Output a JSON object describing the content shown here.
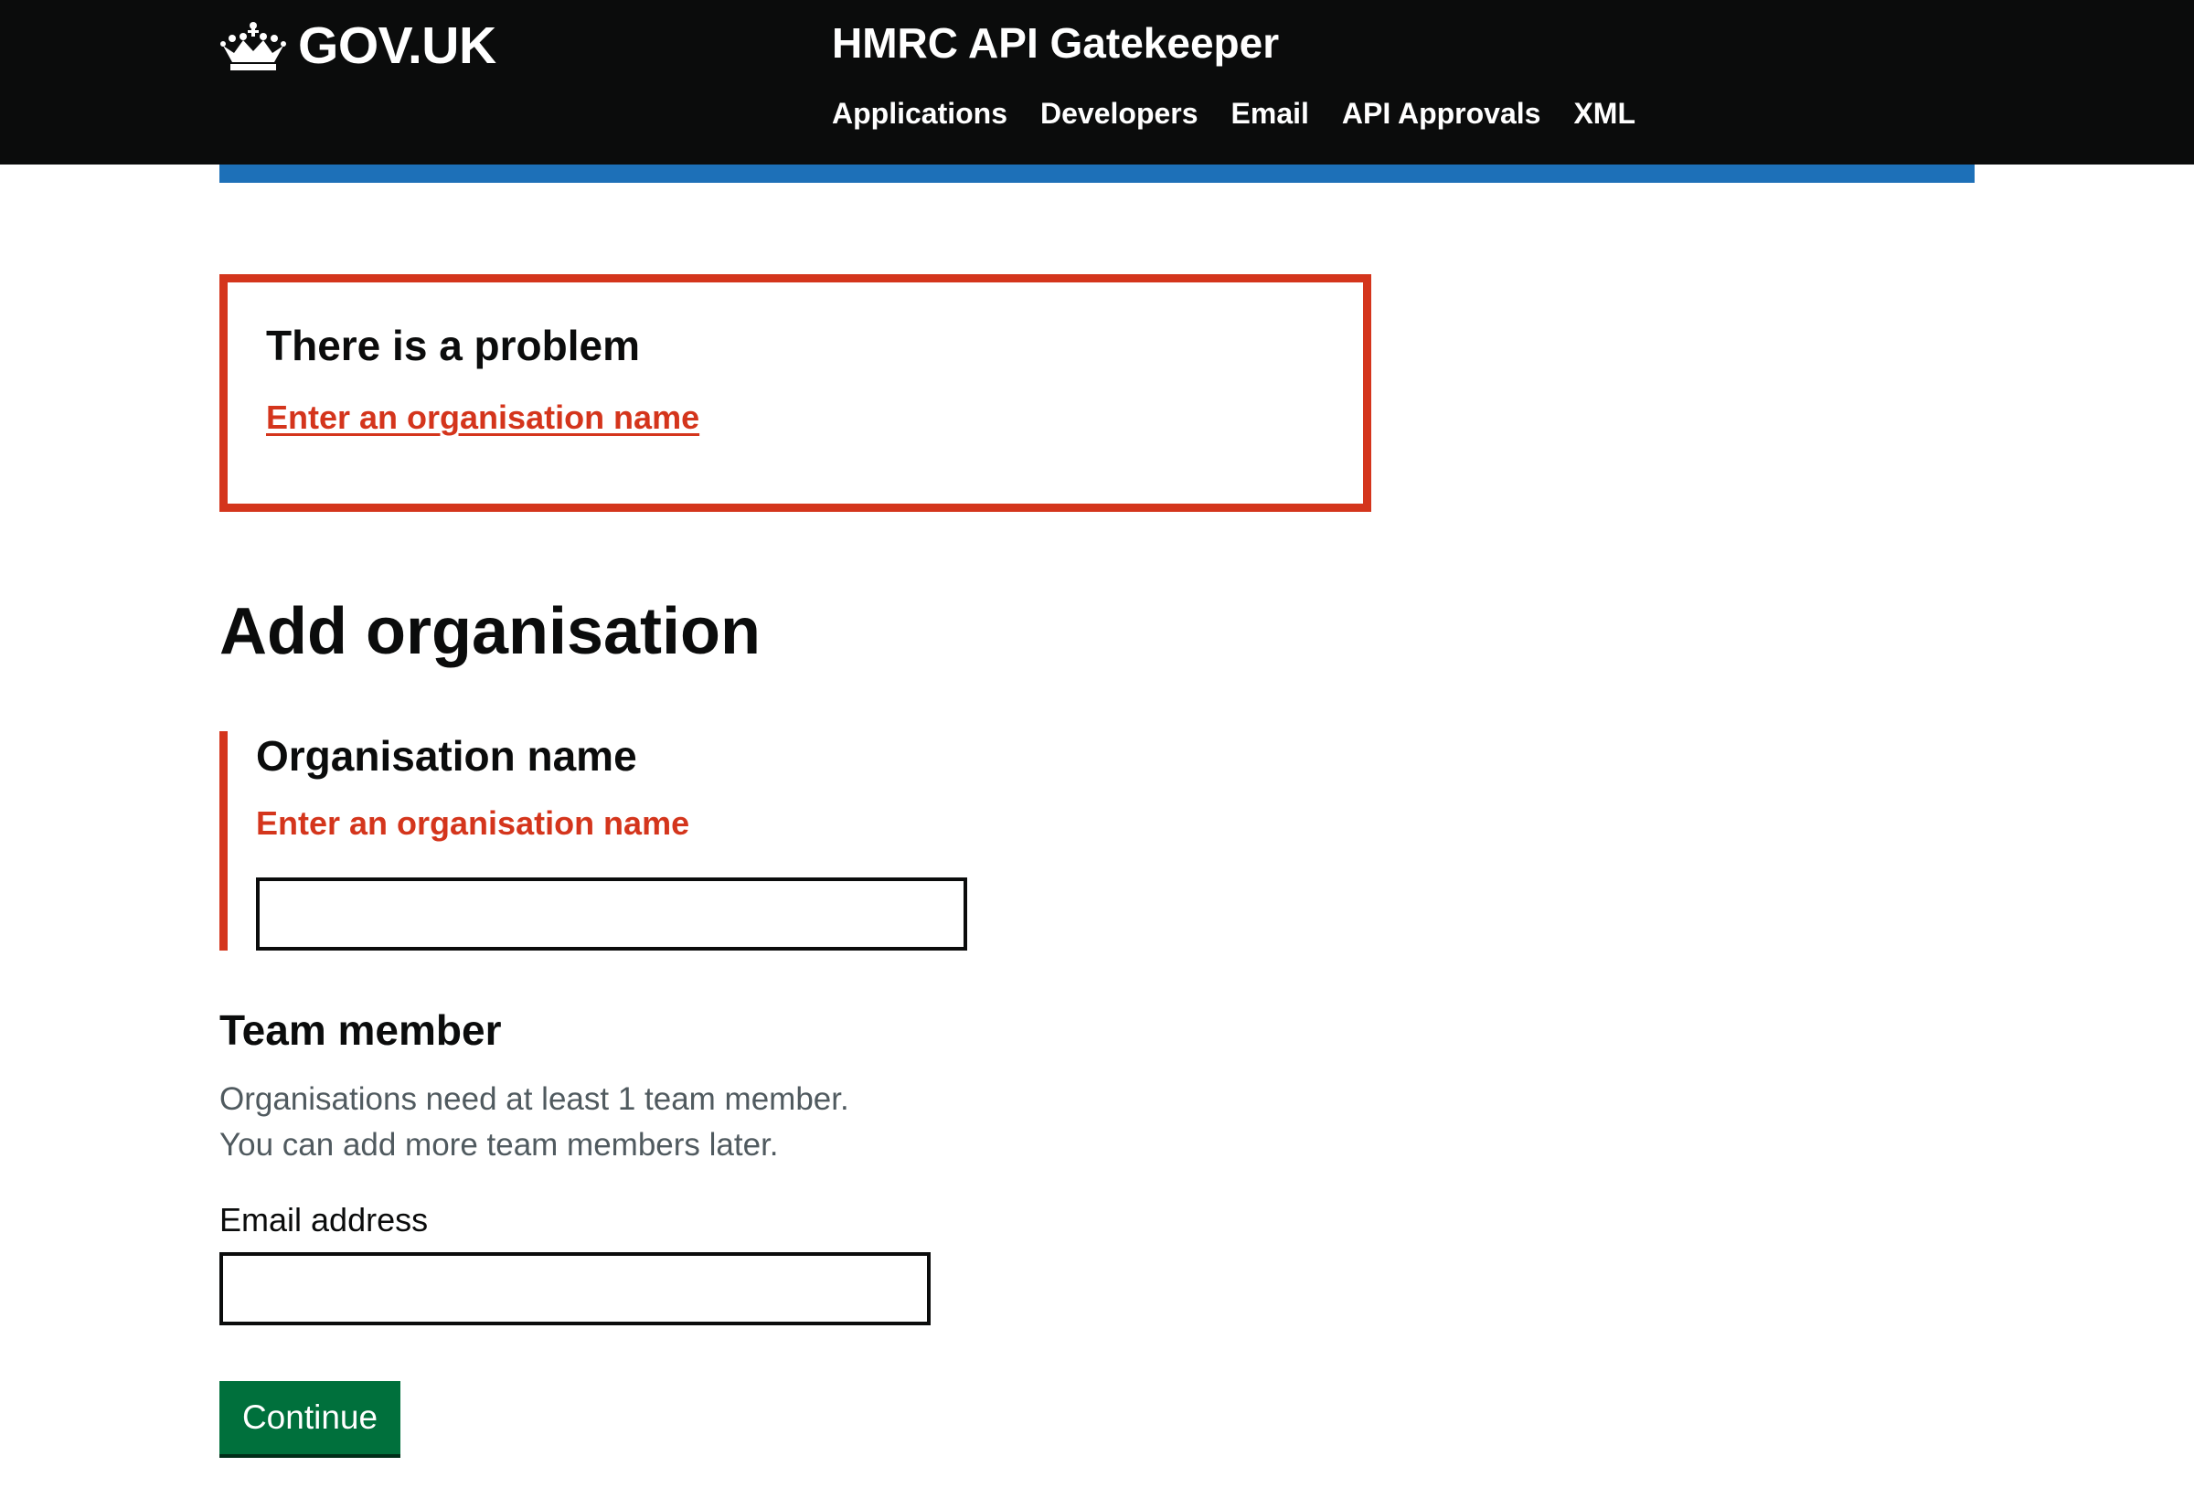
{
  "header": {
    "logo_text": "GOV.UK",
    "logo_icon": "crown-icon",
    "service_name": "HMRC API Gatekeeper",
    "nav_items": [
      {
        "label": "Applications"
      },
      {
        "label": "Developers"
      },
      {
        "label": "Email"
      },
      {
        "label": "API Approvals"
      },
      {
        "label": "XML"
      }
    ]
  },
  "error_summary": {
    "title": "There is a problem",
    "link_text": "Enter an organisation name"
  },
  "page": {
    "title": "Add organisation"
  },
  "organisation_field": {
    "label": "Organisation name",
    "error": "Enter an organisation name",
    "value": ""
  },
  "team_member": {
    "heading": "Team member",
    "hint_line1": "Organisations need at least 1 team member.",
    "hint_line2": "You can add more team members later.",
    "email_label": "Email address",
    "email_value": ""
  },
  "actions": {
    "continue_label": "Continue"
  },
  "colors": {
    "header_bg": "#0b0c0c",
    "accent_blue": "#1d70b8",
    "error_red": "#d4351c",
    "button_green": "#00703c"
  }
}
